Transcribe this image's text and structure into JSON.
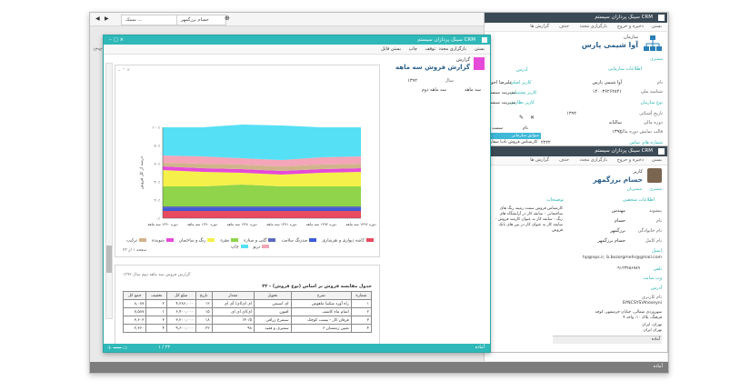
{
  "outer": {
    "tabs": [
      {
        "label": "سینک ..."
      },
      {
        "label": "حسام برزگمهر"
      }
    ],
    "footer_text": "آماده",
    "side_number": "۱۳۹۲"
  },
  "back_window": {
    "title": "سینک پردازان سیستم CRM",
    "toolbar": [
      "بستن",
      "ذخیره و خروج",
      "بازگزاری مجدد",
      "حذف",
      "گزارش ها"
    ],
    "entity_type": "سازمان",
    "entity_name": "آوا شیمی پارس",
    "tag": "مشتری",
    "section_info": "اطلاعات سازمانی",
    "fields": [
      {
        "label": "نام",
        "value": "آوا شیمی پارس"
      },
      {
        "label": "شناسه ملی",
        "value": "۱۴۰۰۳۶۲۶۲۸۴۱"
      },
      {
        "label": "نوع سازمان",
        "value": ""
      },
      {
        "label": "تاریخ آشنائی",
        "value": "۱۳۹۲"
      },
      {
        "label": "دوره مالی",
        "value": "سالیانه"
      },
      {
        "label": "قالب نمایش دوره مالی",
        "value": "۱۳۹۲"
      }
    ],
    "links": [
      "کاربر اصلی",
      "کاربر پشتیبانی",
      "کاربر نظارتی"
    ],
    "link_values": [
      "علیرضا اخوین",
      "مدیریت سیستم",
      "مدیریت سیستم"
    ],
    "section_address": "آدرس",
    "section_phones": "شماره های تماس",
    "grid_header": [
      "سمت",
      "نام"
    ],
    "grid_tab": "سوابق سازمانی",
    "grid_rows": [
      [
        "کارشناس فروش",
        "نادیا صفار"
      ],
      [
        "مدیر فروش",
        "سید حسین پور"
      ]
    ],
    "grid_extra": "۲۲۲۲"
  },
  "user_window": {
    "title": "سینک پردازان سیستم CRM",
    "toolbar": [
      "بستن",
      "ذخیره و خروج",
      "بازگزاری مجدد",
      "حذف",
      "گزارش ها"
    ],
    "role": "کاربر",
    "name": "حسام برزگمهر",
    "tags": [
      "مشتری",
      "مشتریان"
    ],
    "section_personal": "اطلاعات شخصی",
    "fields": [
      {
        "label": "پیشوند",
        "value": "مهندس"
      },
      {
        "label": "نام",
        "value": "حسام"
      },
      {
        "label": "نام خانوادگی",
        "value": "برزگمهر"
      },
      {
        "label": "نام کامل",
        "value": "حسام برزگمهر"
      }
    ],
    "notes_label": "توضیحات",
    "notes": "کارشناس فروش سمت زمینه رنگ های ساختمانی - سابقه کار در آرایشگاه های رنگ - سابقه کار به عنوان کارمند فروش - سابقه کار به عنوان کار در بین های بانک فروش",
    "email_label": "ایمیل",
    "email_value": "hp@nps.ir, b.bozorgmehr@gmail.com",
    "phone_label": "تلفن",
    "phone_value": "۰۹۱۲۳۴۵۶۷۸۹",
    "web_label": "وب سایت",
    "address_label": "آدرس",
    "user_label": "نام کاربری",
    "user_value": "SYNCSYS\\Ahoseyni",
    "address_text": "سهروردی شمالی، خیابان خرمشهر، کوچه فرهنگ، پلاک ۱۰، واحد ۴",
    "city_text": "تهران، ایران",
    "postal_text": "تهران ایران",
    "footer_text": "آماده"
  },
  "front_window": {
    "title": "سینک پردازان سیستم CRM",
    "toolbar": [
      "بستن",
      "بازگزاری مجدد",
      "توقف",
      "چاپ",
      "بستن فایل"
    ],
    "report_type": "گزارش",
    "report_title": "گزارش فروش سه ماهه",
    "year_label": "سال",
    "year_value": "۱۳۹۲",
    "period_label": "سه ماهه دوم",
    "period_value": "سه ماهه",
    "page_label": "صفحه ۱ از ۲۳",
    "footer_text": "آماده",
    "pagination": "۱ / ۲۳",
    "section2_header": "گزارش فروش سه ماهه دوم سال ۱۳۹۲",
    "section2_title": "۳۲ - جدول مقایسه فروش بر اساس (نوع فروش)",
    "table_headers": [
      "شماره",
      "شرح",
      "تحویل",
      "مقدار",
      "تاریخ",
      "مبلغ کل",
      "تخفیف",
      "جمع کل"
    ],
    "table_rows": [
      [
        "۱",
        "راه آورد شکیبا ماهوش",
        "ای اسیمن",
        "ای ای/ای/ آی ای",
        "۱۲",
        "۴,۲۸۶,۰۰۰",
        "۲",
        "۸,۰۸۷"
      ],
      [
        "۲",
        "اتمام ماه کاشف",
        "افیون",
        "ای/ای ای ای",
        "۱۵",
        "۶,۴۰۰,۰۰۰",
        "۱",
        "۷,۵۸۷"
      ],
      [
        "۳",
        "فرقان کار - نیسب کوچک",
        "سیمرغ زرافی",
        "۱۴۰/۵",
        "۱۸",
        "۳,۲۰۰,۰۰۰",
        "۳",
        "۳,۶۰۳"
      ],
      [
        "۴",
        "تعیین زمستان ۶",
        "سفیری و فقیه",
        "۹۸",
        "۲۲",
        "۹,۶۰۰,۰۰۰",
        "۴",
        "۲,۳۶۰"
      ]
    ],
    "ylabel": "درصد از کل فروش",
    "xlabels": [
      "دوره ۱۳۹۰ سه ماهه",
      "دوره ۱۳۹۰ سه ماهه",
      "دوره ۱۳۹۱ سه ماهه",
      "دوره ۱۳۹۱ سه ماهه",
      "دوره ۱۳۹۲ سه ماهه",
      "دوره ۱۳۹۲ سه ماهه"
    ],
    "yticks": [
      "۱۰۰٪",
      "۸۰٪",
      "۶۰٪",
      "۴۰٪",
      "۲۰٪",
      "۰٪"
    ]
  },
  "chart_data": {
    "type": "area",
    "title": "",
    "xlabel": "",
    "ylabel": "درصد از کل فروش",
    "ylim": [
      0,
      100
    ],
    "x": [
      "دوره ۱۳۹۰ سه ماهه",
      "دوره ۱۳۹۰ سه ماهه",
      "دوره ۱۳۹۱ سه ماهه",
      "دوره ۱۳۹۱ سه ماهه",
      "دوره ۱۳۹۲ سه ماهه",
      "دوره ۱۳۹۲ سه ماهه"
    ],
    "series": [
      {
        "name": "کاشه دیواری و نقرشاری",
        "color": "#e84a5f",
        "values": [
          8,
          8,
          8,
          8,
          8,
          8
        ]
      },
      {
        "name": "ضدزنگ سلامت",
        "color": "#3d5bd9",
        "values": [
          3,
          3,
          3,
          3,
          3,
          3
        ]
      },
      {
        "name": "گلنی و ستاره",
        "color": "#5c6bc0",
        "values": [
          2,
          2,
          2,
          2,
          2,
          2
        ]
      },
      {
        "name": "مقره",
        "color": "#8fd44a",
        "values": [
          22,
          22,
          24,
          22,
          22,
          22
        ]
      },
      {
        "name": "رنگ و ساختمان",
        "color": "#f5f04a",
        "values": [
          18,
          16,
          13,
          13,
          15,
          16
        ]
      },
      {
        "name": "شوینده",
        "color": "#e64ad8",
        "values": [
          4,
          4,
          4,
          4,
          4,
          4
        ]
      },
      {
        "name": "ترکیب",
        "color": "#d2b48c",
        "values": [
          4,
          5,
          5,
          5,
          5,
          5
        ]
      },
      {
        "name": "تریو",
        "color": "#f4a5b8",
        "values": [
          8,
          8,
          7,
          7,
          8,
          8
        ]
      },
      {
        "name": "چاپ",
        "color": "#56e0f5",
        "values": [
          31,
          32,
          37,
          38,
          33,
          32
        ]
      }
    ],
    "legend_position": "bottom",
    "grid": false
  }
}
